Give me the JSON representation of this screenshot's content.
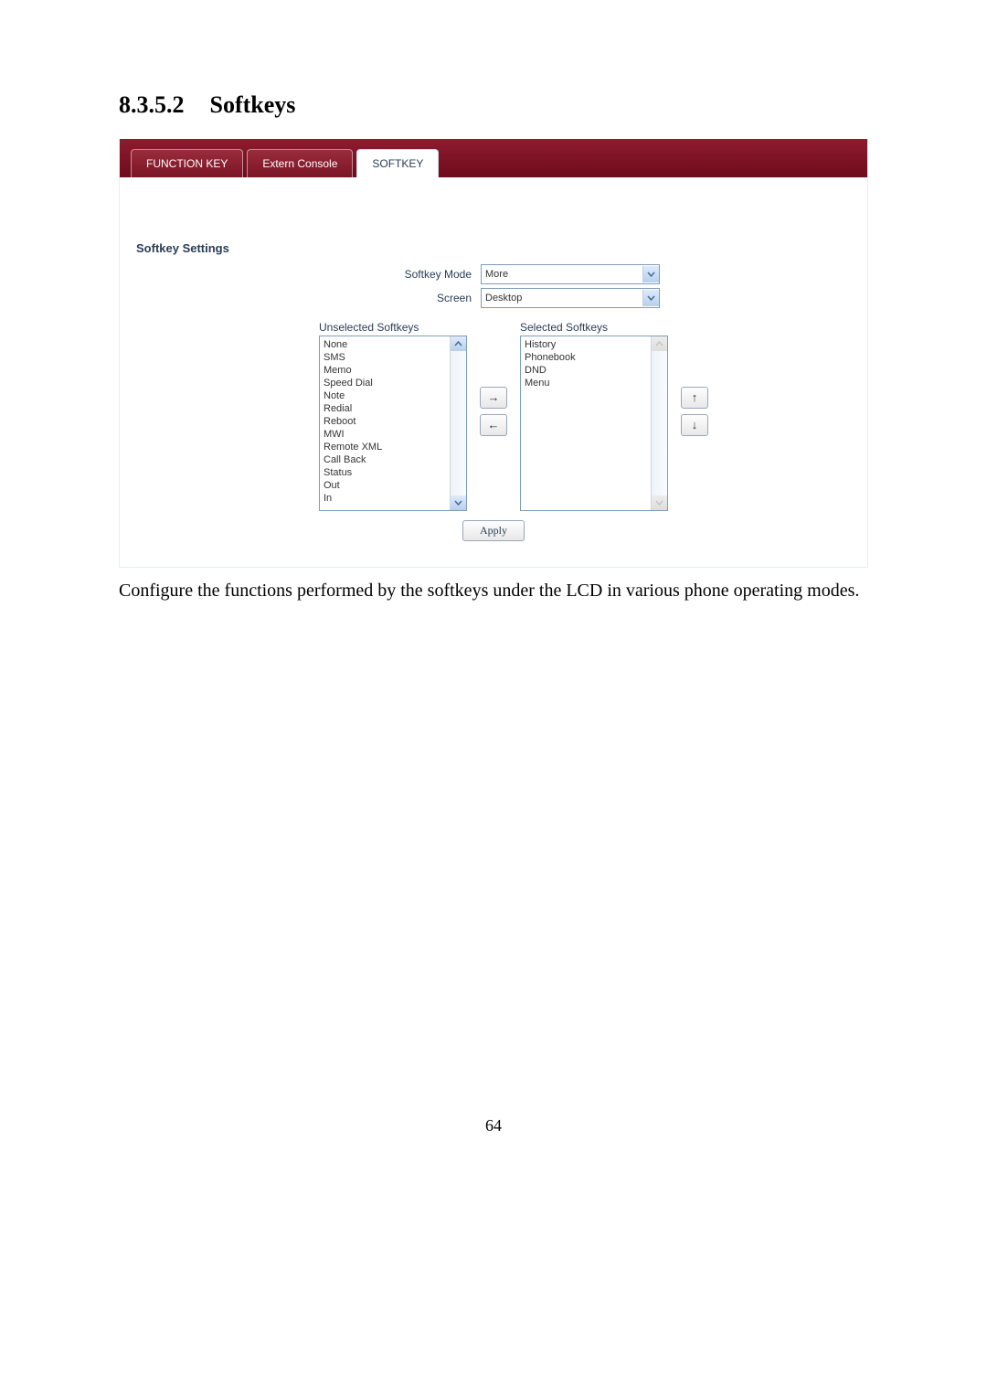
{
  "heading": {
    "number": "8.3.5.2",
    "title": "Softkeys"
  },
  "tabs": {
    "function_key": "FUNCTION KEY",
    "extern_console": "Extern Console",
    "softkey": "SOFTKEY"
  },
  "section_title": "Softkey Settings",
  "fields": {
    "softkey_mode_label": "Softkey Mode",
    "softkey_mode_value": "More",
    "screen_label": "Screen",
    "screen_value": "Desktop"
  },
  "columns": {
    "unselected_title": "Unselected Softkeys",
    "selected_title": "Selected Softkeys"
  },
  "unselected_items": [
    "None",
    "SMS",
    "Memo",
    "Speed Dial",
    "Note",
    "Redial",
    "Reboot",
    "MWI",
    "Remote XML",
    "Call Back",
    "Status",
    "Out",
    "In"
  ],
  "selected_items": [
    "History",
    "Phonebook",
    "DND",
    "Menu"
  ],
  "buttons": {
    "move_right": "→",
    "move_left": "←",
    "move_up": "↑",
    "move_down": "↓",
    "apply": "Apply"
  },
  "caption": "Configure the functions performed by the softkeys under the LCD in various phone operating modes.",
  "page_number": "64"
}
